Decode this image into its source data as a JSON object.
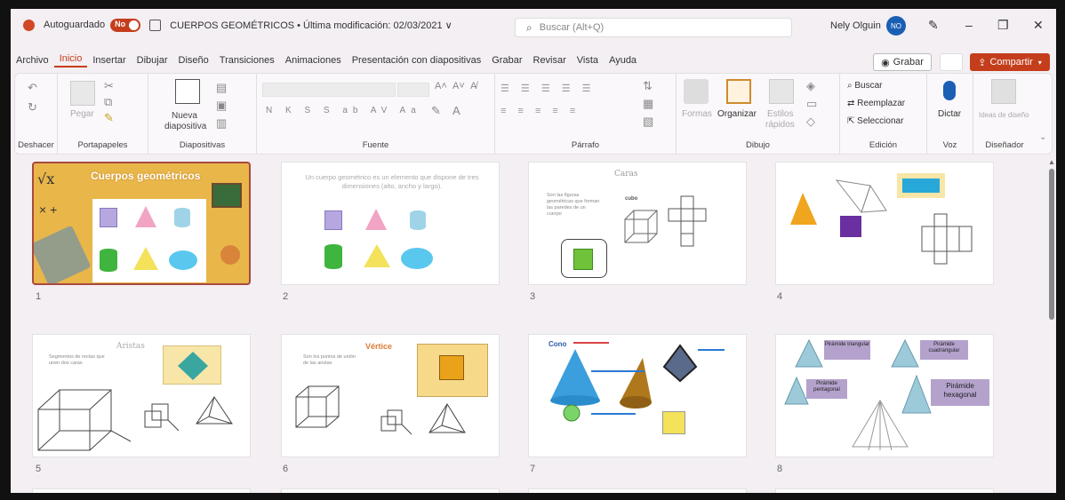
{
  "titlebar": {
    "autosave_label": "Autoguardado",
    "toggle_state": "No",
    "doc_title": "CUERPOS GEOMÉTRICOS • Última modificación: 02/03/2021 ∨",
    "search_placeholder": "Buscar (Alt+Q)",
    "user_name": "Nely Olguin",
    "avatar_initials": "NO"
  },
  "menu": {
    "tabs": [
      "Archivo",
      "Inicio",
      "Insertar",
      "Dibujar",
      "Diseño",
      "Transiciones",
      "Animaciones",
      "Presentación con diapositivas",
      "Grabar",
      "Revisar",
      "Vista",
      "Ayuda"
    ],
    "active_tab": "Inicio",
    "grabar_label": "Grabar",
    "share_label": "Compartir"
  },
  "ribbon": {
    "groups": [
      "Deshacer",
      "Portapapeles",
      "Diapositivas",
      "Fuente",
      "Párrafo",
      "Dibujo",
      "Edición",
      "Voz",
      "Diseñador"
    ],
    "pegar_label": "Pegar",
    "nueva_label": "Nueva",
    "diapositiva_label": "diapositiva",
    "formas_label": "Formas",
    "organizar_label": "Organizar",
    "estilos_label": "Estilos",
    "rapidos_label": "rápidos",
    "buscar_label": "Buscar",
    "reemplazar_label": "Reemplazar",
    "seleccionar_label": "Seleccionar",
    "dictar_label": "Dictar",
    "ideas_label": "Ideas de diseño"
  },
  "slides": [
    {
      "number": "1",
      "title": "Cuerpos geométricos"
    },
    {
      "number": "2",
      "text": "Un cuerpo geométrico es un elemento que dispone de tres dimensiones (alto, ancho y largo)."
    },
    {
      "number": "3",
      "title": "Caras",
      "text": "Son las figuras geométricas que forman las paredes de un cuerpo",
      "label": "cubo"
    },
    {
      "number": "4"
    },
    {
      "number": "5",
      "title": "Aristas",
      "text": "Segmentos de rectas que unen dos caras"
    },
    {
      "number": "6",
      "title": "Vértice",
      "text": "Son los puntos de unión de las aristas"
    },
    {
      "number": "7",
      "title": "Cono"
    },
    {
      "number": "8",
      "labels": [
        "Pirámide triangular",
        "Pirámide cuadrangular",
        "Pirámide pentagonal",
        "Pirámide hexagonal"
      ]
    }
  ],
  "colors": {
    "accent": "#c43e1c",
    "selected_border": "#a84a3d",
    "slide1_bg": "#e9b64a"
  }
}
